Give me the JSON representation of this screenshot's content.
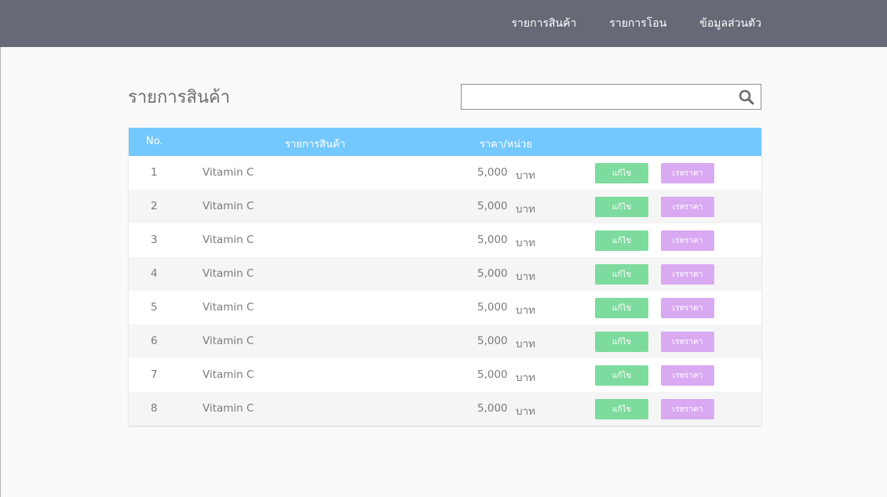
{
  "nav": {
    "items": [
      "รายการสินค้า",
      "รายการโอน",
      "ข้อมูลส่วนตัว"
    ]
  },
  "page": {
    "title": "รายการสินค้า"
  },
  "search": {
    "value": "",
    "placeholder": ""
  },
  "table": {
    "headers": {
      "no": "No.",
      "name": "รายการสินค้า",
      "price": "ราคา/หน่วย"
    },
    "rows": [
      {
        "no": "1",
        "name": "Vitamin C",
        "price": "5,000",
        "unit": "บาท"
      },
      {
        "no": "2",
        "name": "Vitamin C",
        "price": "5,000",
        "unit": "บาท"
      },
      {
        "no": "3",
        "name": "Vitamin C",
        "price": "5,000",
        "unit": "บาท"
      },
      {
        "no": "4",
        "name": "Vitamin C",
        "price": "5,000",
        "unit": "บาท"
      },
      {
        "no": "5",
        "name": "Vitamin C",
        "price": "5,000",
        "unit": "บาท"
      },
      {
        "no": "6",
        "name": "Vitamin C",
        "price": "5,000",
        "unit": "บาท"
      },
      {
        "no": "7",
        "name": "Vitamin C",
        "price": "5,000",
        "unit": "บาท"
      },
      {
        "no": "8",
        "name": "Vitamin C",
        "price": "5,000",
        "unit": "บาท"
      }
    ],
    "edit_label": "แก้ไข",
    "price_label": "เรทราคา"
  },
  "colors": {
    "topbar": "#666a76",
    "table_header": "#73c8fd",
    "edit_button": "#7edb9e",
    "price_button": "#d9aaf2"
  },
  "icons": {
    "search": "search-icon"
  }
}
